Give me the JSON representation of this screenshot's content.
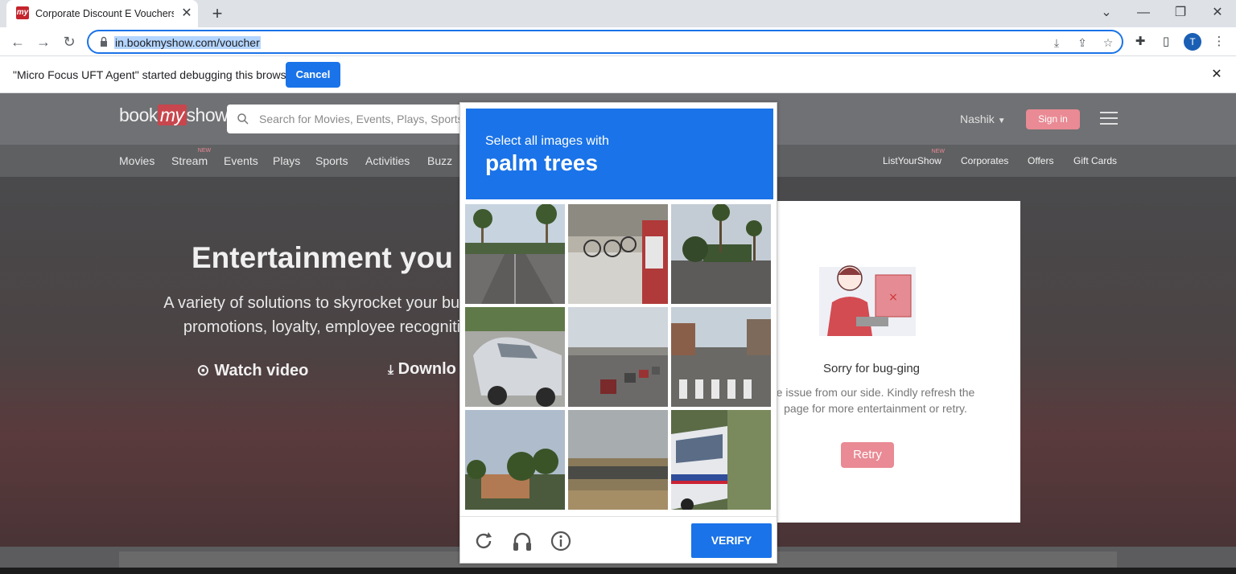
{
  "browser": {
    "tab_title": "Corporate Discount E Vouchers |",
    "url": "in.bookmyshow.com/voucher",
    "avatar_letter": "T"
  },
  "infobar": {
    "message": "\"Micro Focus UFT Agent\" started debugging this browser",
    "cancel_label": "Cancel"
  },
  "site": {
    "logo_book": "book",
    "logo_my": "my",
    "logo_show": "show",
    "search_placeholder": "Search for Movies, Events, Plays, Sports",
    "city": "Nashik",
    "signin_label": "Sign in",
    "nav_left": [
      "Movies",
      "Stream",
      "Events",
      "Plays",
      "Sports",
      "Activities",
      "Buzz"
    ],
    "nav_right": [
      "ListYourShow",
      "Corporates",
      "Offers",
      "Gift Cards"
    ],
    "new_tag": "NEW"
  },
  "hero": {
    "title": "Entertainment you ca",
    "subtitle_line1": "A variety of solutions to skyrocket your busin",
    "subtitle_line2": "promotions, loyalty, employee recogniti",
    "watch_label": "Watch video",
    "download_label": "Downlo"
  },
  "error_card": {
    "title": "Sorry for bug-ging",
    "text_line1": "e issue from our side. Kindly refresh the",
    "text_line2": "page for more entertainment or retry.",
    "retry_label": "Retry"
  },
  "captcha": {
    "prompt": "Select all images with",
    "object": "palm trees",
    "verify_label": "VERIFY"
  },
  "colors": {
    "accent": "#1a73e8",
    "brand": "#c4242c",
    "signin": "#e98a94"
  }
}
